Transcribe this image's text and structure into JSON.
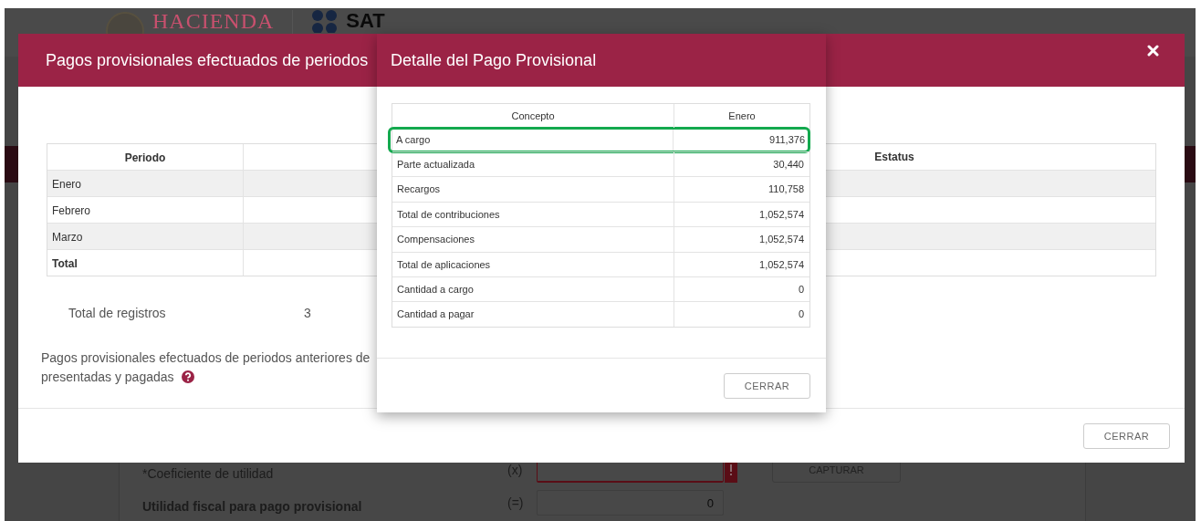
{
  "page": {
    "logo": {
      "left_text": "HACIENDA",
      "right_text": "SAT"
    },
    "form_rows": [
      {
        "kind": "input",
        "label": "*Coeficiente de utilidad",
        "operator": "(x)",
        "error": true,
        "button": "CAPTURAR"
      },
      {
        "kind": "output",
        "label": "Utilidad fiscal para pago provisional",
        "operator": "(=)",
        "value": "0",
        "error": false
      }
    ]
  },
  "dialog": {
    "title": "Pagos provisionales efectuados de periodos",
    "table": {
      "columns": {
        "periodo": "Periodo",
        "estatus": "Estatus"
      },
      "rows": [
        {
          "kind": "month",
          "periodo": "Enero"
        },
        {
          "kind": "month",
          "periodo": "Febrero"
        },
        {
          "kind": "month",
          "periodo": "Marzo"
        },
        {
          "kind": "total",
          "periodo": "Total"
        }
      ]
    },
    "record_count": {
      "label": "Total de registros",
      "value": "3"
    },
    "note_lines": [
      "Pagos provisionales efectuados de periodos anteriores de",
      "presentadas y pagadas"
    ],
    "close_button": "CERRAR"
  },
  "detail": {
    "title": "Detalle del Pago Provisional",
    "columns": [
      "Concepto",
      "Enero"
    ],
    "rows": [
      {
        "concept": "A cargo",
        "value": "911,376",
        "highlighted": true
      },
      {
        "concept": "Parte actualizada",
        "value": "30,440",
        "highlighted": false
      },
      {
        "concept": "Recargos",
        "value": "110,758",
        "highlighted": false
      },
      {
        "concept": "Total de contribuciones",
        "value": "1,052,574",
        "highlighted": false
      },
      {
        "concept": "Compensaciones",
        "value": "1,052,574",
        "highlighted": false
      },
      {
        "concept": "Total de aplicaciones",
        "value": "1,052,574",
        "highlighted": false
      },
      {
        "concept": "Cantidad a cargo",
        "value": "0",
        "highlighted": false
      },
      {
        "concept": "Cantidad a pagar",
        "value": "0",
        "highlighted": false
      }
    ],
    "close_button": "CERRAR"
  }
}
